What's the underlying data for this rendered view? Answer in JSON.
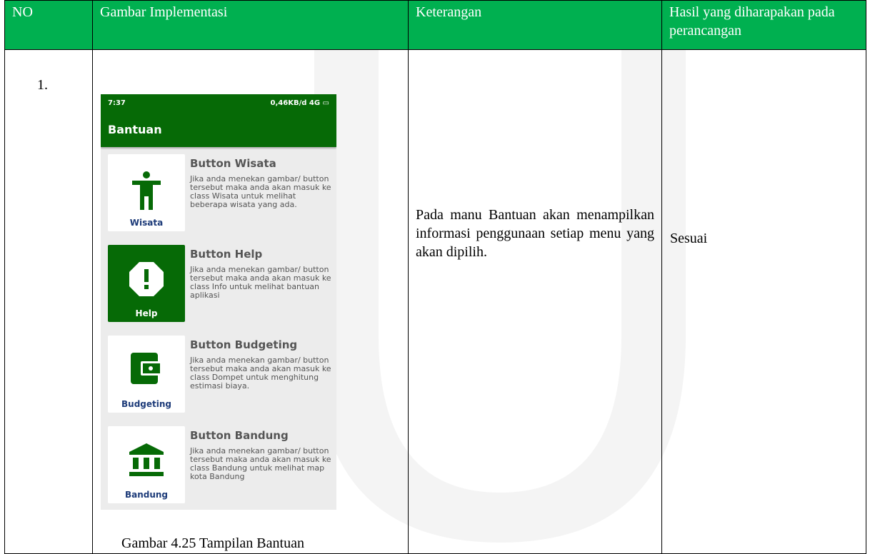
{
  "table": {
    "headers": [
      "NO",
      "Gambar Implementasi",
      "Keterangan",
      "Hasil yang diharapakan pada perancangan"
    ],
    "row": {
      "no": "1.",
      "caption": "Gambar 4.25 Tampilan Bantuan",
      "description": "Pada manu Bantuan akan menampilkan informasi penggunaan setiap menu yang akan dipilih.",
      "result": "Sesuai"
    }
  },
  "phone": {
    "status_time": "7:37",
    "status_right": "0,46KB/d",
    "status_network": "4G",
    "title": "Bantuan",
    "items": [
      {
        "label": "Wisata",
        "title": "Button Wisata",
        "body": "Jika anda menekan gambar/ button tersebut maka anda akan masuk ke class Wisata untuk melihat beberapa wisata yang ada.",
        "icon": "person-icon"
      },
      {
        "label": "Help",
        "title": "Button Help",
        "body": "Jika anda menekan gambar/ button tersebut maka anda akan masuk ke class Info untuk melihat bantuan aplikasi",
        "icon": "alert-icon"
      },
      {
        "label": "Budgeting",
        "title": "Button Budgeting",
        "body": "Jika anda menekan gambar/ button tersebut maka anda akan masuk ke class Dompet untuk menghitung estimasi biaya.",
        "icon": "wallet-icon"
      },
      {
        "label": "Bandung",
        "title": "Button Bandung",
        "body": "Jika anda menekan gambar/ button tersebut maka anda akan masuk ke class Bandung untuk melihat map kota Bandung",
        "icon": "bank-icon"
      }
    ],
    "colors": {
      "primary": "#066a06",
      "label": "#1d3b79",
      "background": "#ececec"
    }
  },
  "header_color": "#00b050"
}
